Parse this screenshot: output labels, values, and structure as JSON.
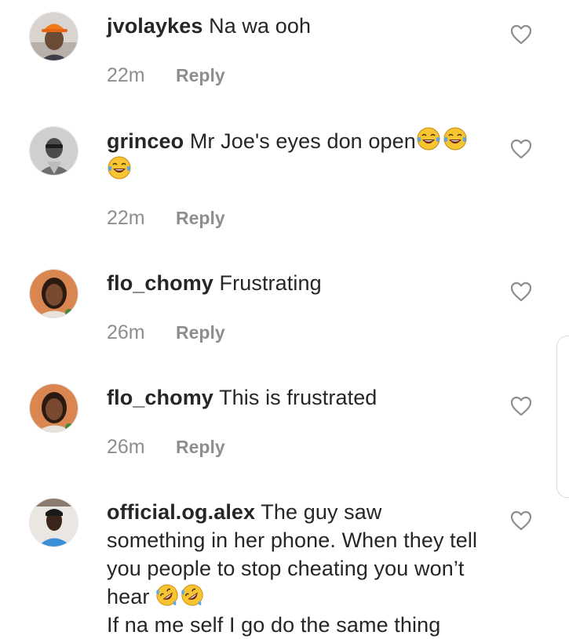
{
  "comments": [
    {
      "username": "jvolaykes",
      "text": "Na wa ooh",
      "time": "22m",
      "reply_label": "Reply",
      "avatar_icon": "avatar-orange-cap"
    },
    {
      "username": "grinceo",
      "text_line1": "Mr Joe's eyes don open",
      "time": "22m",
      "reply_label": "Reply",
      "emoji": [
        "face-with-tears-of-joy",
        "face-with-tears-of-joy",
        "face-with-tears-of-joy"
      ],
      "avatar_icon": "avatar-man-grayscale"
    },
    {
      "username": "flo_chomy",
      "text": "Frustrating",
      "time": "26m",
      "reply_label": "Reply",
      "avatar_icon": "avatar-woman-portrait"
    },
    {
      "username": "flo_chomy",
      "text": "This is frustrated",
      "time": "26m",
      "reply_label": "Reply",
      "avatar_icon": "avatar-woman-portrait"
    },
    {
      "username": "official.og.alex",
      "text_line1": "The guy saw",
      "text_line2": "something in her phone. When they tell",
      "text_line3": "you people to stop cheating you won’t",
      "text_line4": "hear",
      "text_line5": "If na me self I go do the same thing",
      "emoji": [
        "rolling-on-the-floor-laughing",
        "rolling-on-the-floor-laughing"
      ],
      "avatar_icon": "avatar-man-blue-shirt"
    }
  ],
  "colors": {
    "text": "#262626",
    "meta": "#8e8e8e",
    "heart_outline": "#8e8e8e",
    "emoji_yellow": "#f7c531"
  }
}
